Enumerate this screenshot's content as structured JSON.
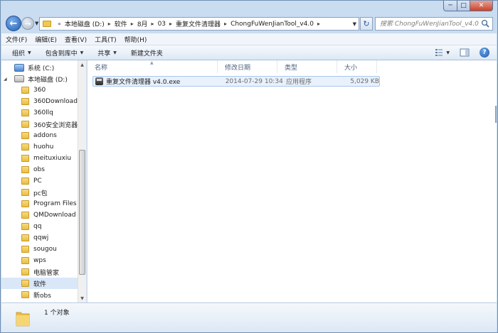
{
  "window": {
    "controls": {
      "minimize": "─",
      "maximize": "□",
      "close": "✕"
    }
  },
  "address": {
    "back_glyph": "←",
    "forward_glyph": "→",
    "lead": "«",
    "crumbs": [
      "本地磁盘 (D:)",
      "软件",
      "8月",
      "03",
      "重复文件清理器",
      "ChongFuWenJianTool_v4.0"
    ],
    "sep": "▸",
    "refresh_glyph": "↻"
  },
  "search": {
    "placeholder": "搜索 ChongFuWenJianTool_v4.0"
  },
  "menu": [
    "文件(F)",
    "编辑(E)",
    "查看(V)",
    "工具(T)",
    "帮助(H)"
  ],
  "commands": {
    "organize": "组织",
    "include_library": "包含到库中",
    "share": "共享",
    "new_folder": "新建文件夹",
    "help": "?"
  },
  "tree": {
    "drive_c": "系统 (C:)",
    "drive_d": "本地磁盘 (D:)",
    "folders": [
      "360",
      "360Downloads",
      "360llq",
      "360安全浏览器",
      "addons",
      "huohu",
      "meituxiuxiu",
      "obs",
      "PC",
      "pc包",
      "Program Files",
      "QMDownload",
      "qq",
      "qqwj",
      "sougou",
      "wps",
      "电脑管家",
      "软件",
      "新obs"
    ],
    "selected": "软件"
  },
  "columns": {
    "name": "名称",
    "date": "修改日期",
    "type": "类型",
    "size": "大小"
  },
  "files": [
    {
      "name": "重复文件清理器 v4.0.exe",
      "date": "2014-07-29 10:34",
      "type": "应用程序",
      "size": "5,029 KB"
    }
  ],
  "details": {
    "count": "1 个对象"
  },
  "colors": {
    "window_frame": "#c9dcf0",
    "selection": "#e8f1fc",
    "accent": "#1f5fb5"
  }
}
